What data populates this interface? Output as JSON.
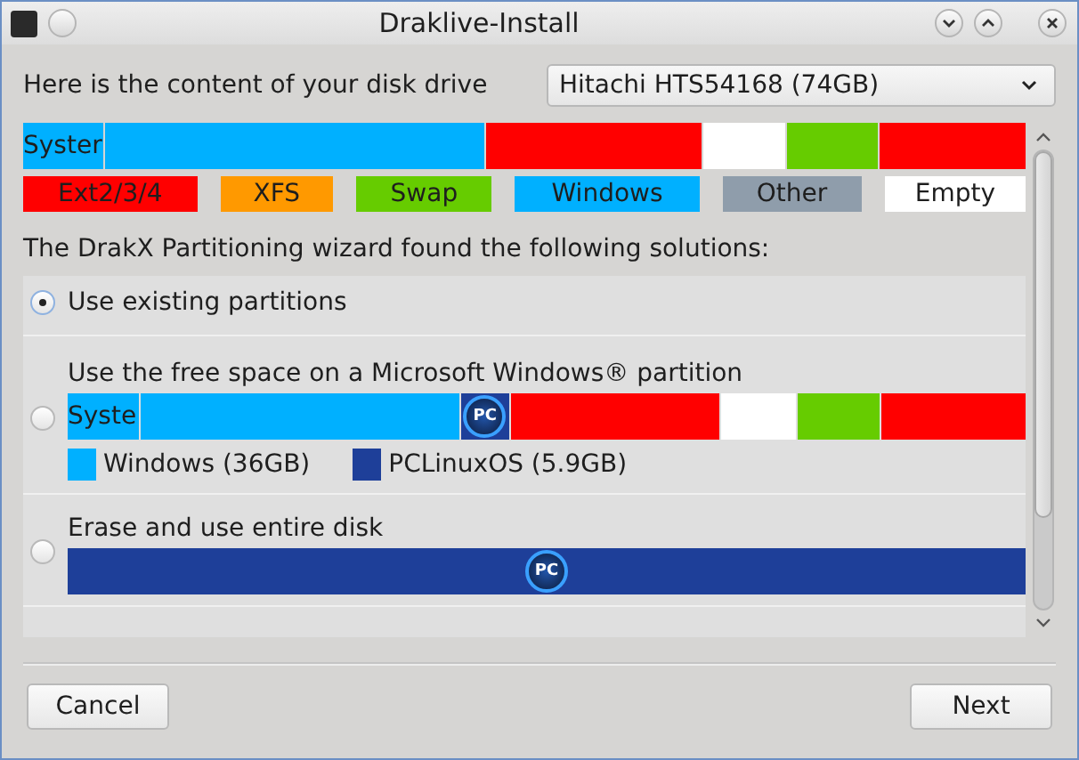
{
  "window": {
    "title": "Draklive-Install"
  },
  "disk": {
    "label": "Here is the content of your disk drive",
    "drive": "Hitachi HTS54168 (74GB)"
  },
  "disk_bar": [
    {
      "kind": "windows",
      "label": "Syster"
    },
    {
      "kind": "windows"
    },
    {
      "kind": "ext"
    },
    {
      "kind": "empty"
    },
    {
      "kind": "swap"
    },
    {
      "kind": "ext"
    }
  ],
  "legend": [
    {
      "kind": "ext",
      "label": "Ext2/3/4"
    },
    {
      "kind": "xfs",
      "label": "XFS"
    },
    {
      "kind": "swap",
      "label": "Swap"
    },
    {
      "kind": "windows",
      "label": "Windows"
    },
    {
      "kind": "other",
      "label": "Other"
    },
    {
      "kind": "empty",
      "label": "Empty"
    }
  ],
  "intro": "The DrakX Partitioning wizard found the following solutions:",
  "options": [
    {
      "kind": "plain",
      "label": "Use existing partitions",
      "selected": true
    },
    {
      "kind": "resize",
      "label": "Use the free space on a Microsoft Windows® partition",
      "selected": false,
      "bar": [
        {
          "kind": "windows",
          "label": "Syste"
        },
        {
          "kind": "windows"
        },
        {
          "kind": "pclinux",
          "logo": "PC"
        },
        {
          "kind": "ext"
        },
        {
          "kind": "empty"
        },
        {
          "kind": "swap"
        },
        {
          "kind": "ext"
        }
      ],
      "legend": [
        {
          "kind": "windows",
          "label": "Windows (36GB)"
        },
        {
          "kind": "pclinux",
          "label": "PCLinuxOS (5.9GB)"
        }
      ]
    },
    {
      "kind": "erase",
      "label": "Erase and use entire disk",
      "selected": false,
      "bar": [
        {
          "kind": "pclinux",
          "logo": "PC"
        }
      ]
    }
  ],
  "buttons": [
    {
      "label": "Cancel"
    },
    {
      "label": "Next"
    }
  ]
}
